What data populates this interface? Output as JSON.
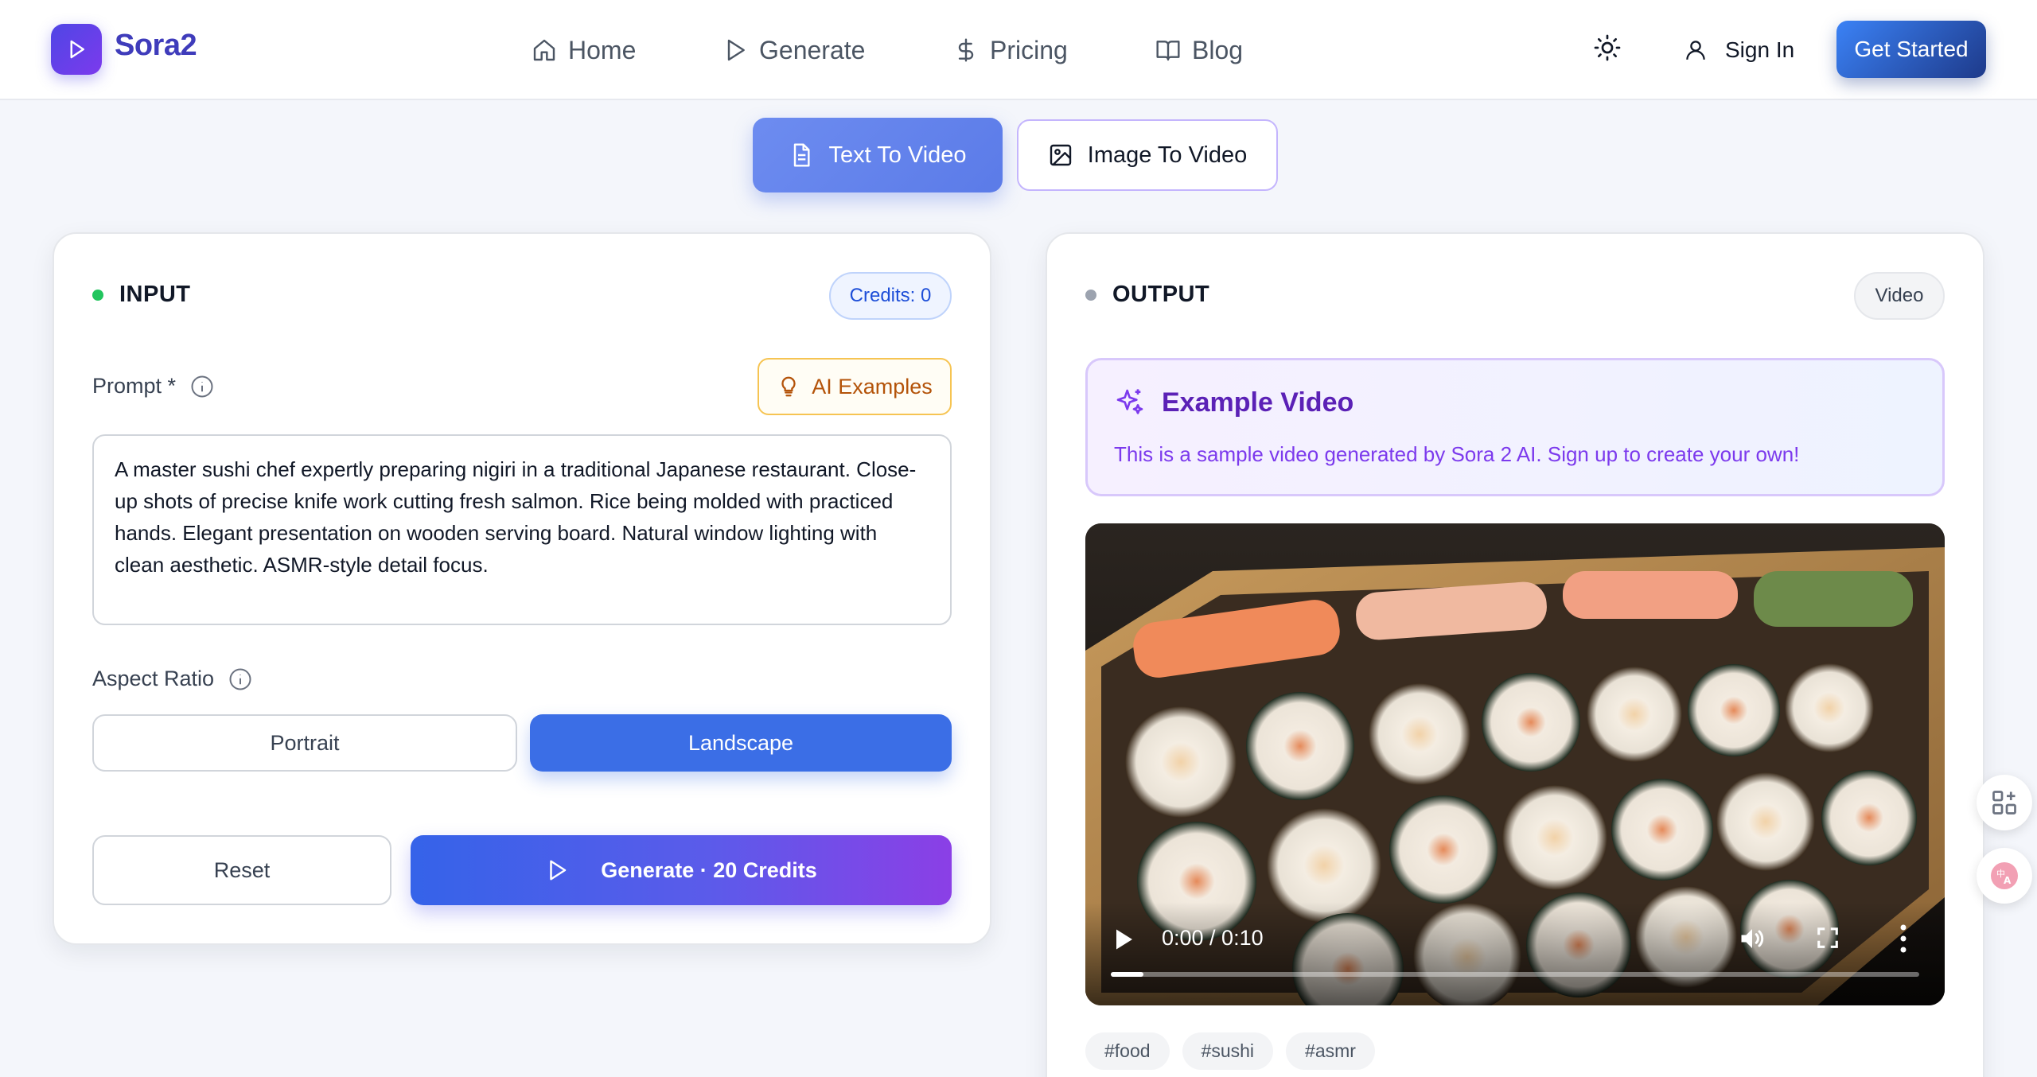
{
  "header": {
    "brand": "Sora2",
    "nav": [
      {
        "label": "Home",
        "icon": "home-icon"
      },
      {
        "label": "Generate",
        "icon": "play-icon"
      },
      {
        "label": "Pricing",
        "icon": "dollar-icon"
      },
      {
        "label": "Blog",
        "icon": "book-icon"
      }
    ],
    "sign_in": "Sign In",
    "get_started": "Get Started"
  },
  "modes": {
    "text_to_video": "Text To Video",
    "image_to_video": "Image To Video",
    "active": "Text To Video"
  },
  "input": {
    "title": "INPUT",
    "credits": "Credits: 0",
    "prompt_label": "Prompt *",
    "ai_examples": "AI Examples",
    "prompt_value": "A master sushi chef expertly preparing nigiri in a traditional Japanese restaurant. Close-up shots of precise knife work cutting fresh salmon. Rice being molded with practiced hands. Elegant presentation on wooden serving board. Natural window lighting with clean aesthetic. ASMR-style detail focus.",
    "aspect_label": "Aspect Ratio",
    "aspect_options": [
      "Portrait",
      "Landscape"
    ],
    "aspect_selected": "Landscape",
    "reset": "Reset",
    "generate": "Generate · 20 Credits"
  },
  "output": {
    "title": "OUTPUT",
    "badge": "Video",
    "example_title": "Example Video",
    "example_sub": "This is a sample video generated by Sora 2 AI. Sign up to create your own!",
    "video_time": "0:00 / 0:10",
    "video_progress": 0.04,
    "tags": [
      "#food",
      "#sushi",
      "#asmr"
    ]
  },
  "colors": {
    "brand": "#3f3cbb",
    "accent_blue": "#3b6ee6",
    "input_dot": "#22c55e",
    "output_dot": "#9ca3af"
  }
}
